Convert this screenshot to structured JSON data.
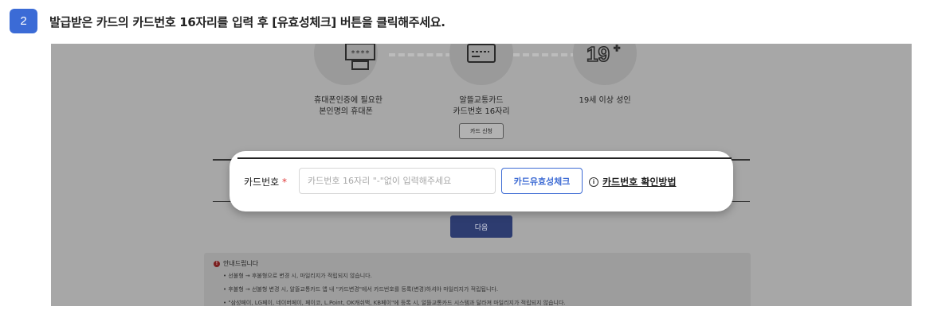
{
  "step": {
    "number": "2",
    "instruction": "발급받은 카드의 카드번호 16자리를 입력 후 [유효성체크] 버튼을 클릭해주세요."
  },
  "requirements": [
    {
      "label_line1": "휴대폰인증에 필요한",
      "label_line2": "본인명의 휴대폰",
      "icon": "phone-icon"
    },
    {
      "label_line1": "알뜰교통카드",
      "label_line2": "카드번호 16자리",
      "icon": "card-icon"
    },
    {
      "label_line1": "19세 이상 성인",
      "label_line2": "",
      "icon": "age-19-icon"
    }
  ],
  "card_apply_label": "카드 신청",
  "card_form": {
    "label": "카드번호",
    "required_mark": "*",
    "placeholder": "카드번호 16자리 \"-\"없이 입력해주세요",
    "value": "",
    "check_button": "카드유효성체크",
    "help_link": "카드번호 확인방법"
  },
  "next_button": "다음",
  "notice": {
    "title": "안내드립니다",
    "lines": [
      "• 선불형 → 후불형으로 변경 시, 마일리지가 적립되지 않습니다.",
      "• 후불형 → 선불형 변경 시, 알뜰교통카드 앱 내 \"카드변경\"에서 카드번호를 등록(변경)하셔야 마일리지가 적립됩니다.",
      "• \"삼성페이, LG페이, 네이버페이, 페이코, L.Point, OK캐쉬백, KB페이\"에 등록 시, 알뜰교통카드 시스템과 달라져 마일리지가 적립되지 않습니다."
    ]
  },
  "colors": {
    "accent": "#3b6bd6",
    "required": "#e03838",
    "overlay": "#a7a7a7"
  }
}
